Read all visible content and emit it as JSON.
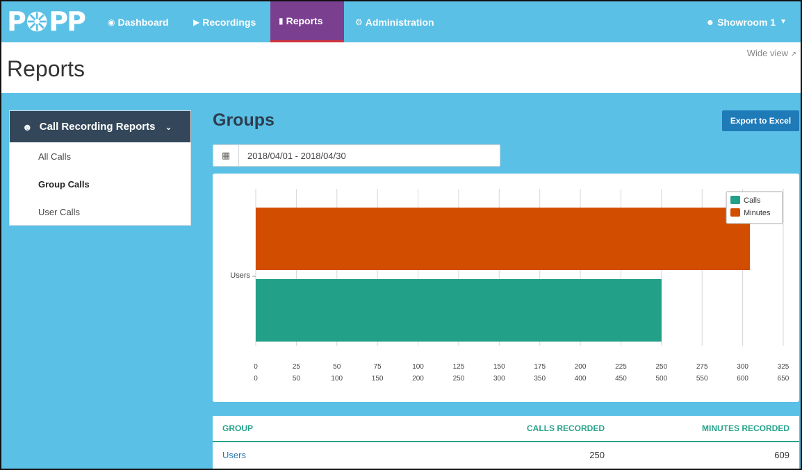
{
  "brand": {
    "logo_text": "POPP"
  },
  "nav": {
    "items": [
      {
        "label": "Dashboard",
        "icon": "dashboard-icon"
      },
      {
        "label": "Recordings",
        "icon": "play-square-icon"
      },
      {
        "label": "Reports",
        "icon": "bar-chart-icon"
      },
      {
        "label": "Administration",
        "icon": "gear-icon"
      }
    ],
    "active": "Reports",
    "user": "Showroom 1"
  },
  "header": {
    "title": "Reports",
    "wide_view": "Wide view"
  },
  "sidebar": {
    "title": "Call Recording Reports",
    "items": [
      {
        "label": "All Calls"
      },
      {
        "label": "Group Calls"
      },
      {
        "label": "User Calls"
      }
    ],
    "active": "Group Calls"
  },
  "main": {
    "title": "Groups",
    "export_label": "Export to Excel",
    "date_range": "2018/04/01 - 2018/04/30"
  },
  "colors": {
    "calls": "#22a088",
    "minutes": "#d24d00",
    "accent": "#27a38a",
    "nav_active": "#7b3f8f"
  },
  "chart_data": {
    "type": "bar",
    "orientation": "horizontal",
    "categories": [
      "Users"
    ],
    "series": [
      {
        "name": "Calls",
        "values": [
          250
        ],
        "axis": "primary"
      },
      {
        "name": "Minutes",
        "values": [
          609
        ],
        "axis": "secondary"
      }
    ],
    "x_ticks_primary": [
      "0",
      "25",
      "50",
      "75",
      "100",
      "125",
      "150",
      "175",
      "200",
      "225",
      "250",
      "275",
      "300",
      "325"
    ],
    "x_ticks_secondary": [
      "0",
      "50",
      "100",
      "150",
      "200",
      "250",
      "300",
      "350",
      "400",
      "450",
      "500",
      "550",
      "600",
      "650"
    ],
    "xlim_primary": [
      0,
      325
    ],
    "xlim_secondary": [
      0,
      650
    ],
    "grid": true,
    "legend": "top-right"
  },
  "table": {
    "headers": [
      "GROUP",
      "CALLS RECORDED",
      "MINUTES RECORDED"
    ],
    "rows": [
      [
        "Users",
        "250",
        "609"
      ]
    ]
  }
}
